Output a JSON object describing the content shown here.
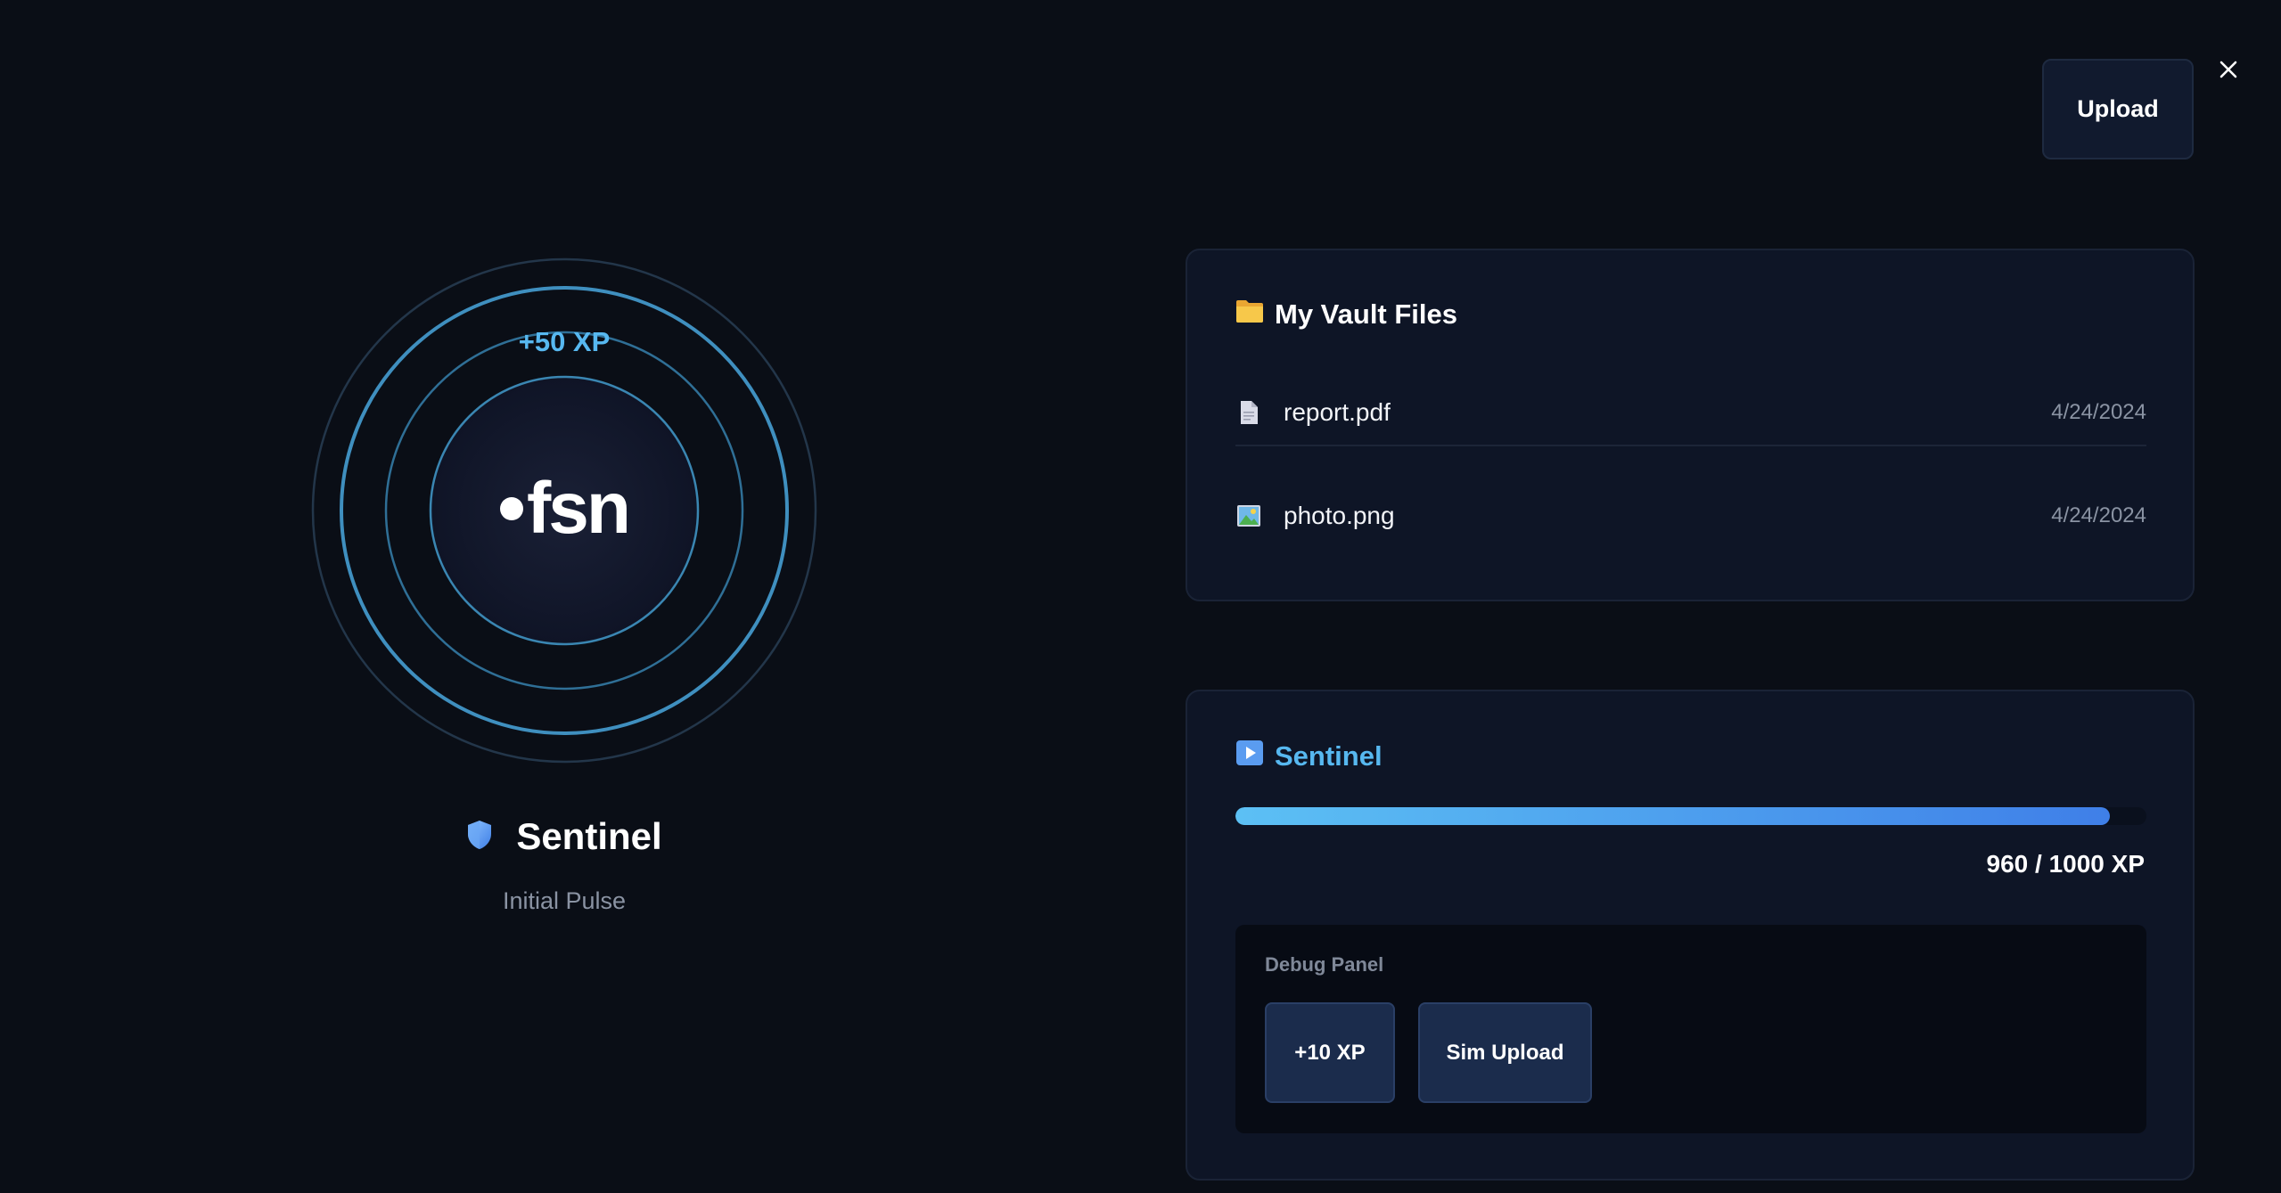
{
  "header": {
    "upload_label": "Upload",
    "close_icon": "close-icon"
  },
  "orb": {
    "xp_gain": "+50 XP",
    "logo_text": "fsn",
    "ring_color": "#3f8fbf"
  },
  "rank": {
    "icon": "shield-icon",
    "name": "Sentinel",
    "subtitle": "Initial Pulse"
  },
  "vault": {
    "icon": "folder-icon",
    "title": "My Vault Files",
    "files": [
      {
        "icon": "document-icon",
        "name": "report.pdf",
        "date": "4/24/2024"
      },
      {
        "icon": "image-icon",
        "name": "photo.png",
        "date": "4/24/2024"
      }
    ]
  },
  "level": {
    "icon": "play-icon",
    "title": "Sentinel",
    "xp_current": 960,
    "xp_max": 1000,
    "xp_text": "960 / 1000 XP",
    "bar_gradient": [
      "#5cc0f4",
      "#3f7fe8"
    ]
  },
  "debug": {
    "title": "Debug Panel",
    "add_xp_label": "+10 XP",
    "sim_upload_label": "Sim Upload"
  }
}
